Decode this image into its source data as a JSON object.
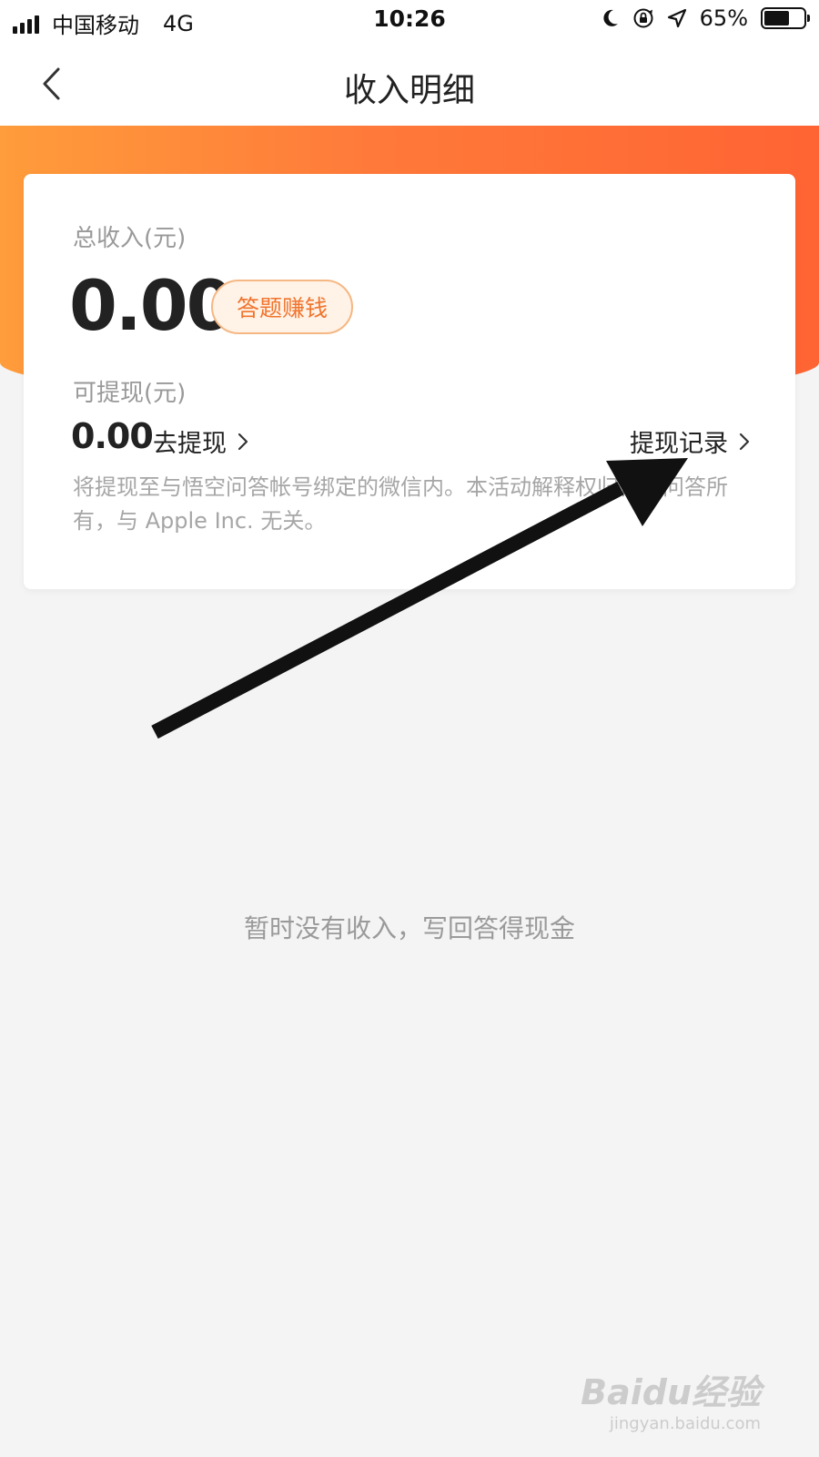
{
  "status_bar": {
    "carrier": "中国移动",
    "network": "4G",
    "time": "10:26",
    "battery": "65%",
    "battery_level": 0.65
  },
  "nav": {
    "title": "收入明细"
  },
  "card": {
    "total_label": "总收入(元)",
    "total_value": "0.00",
    "earn_button": "答题赚钱",
    "withdrawable_label": "可提现(元)",
    "withdrawable_value": "0.00",
    "go_withdraw": "去提现",
    "withdraw_record": "提现记录",
    "notice": "将提现至与悟空问答帐号绑定的微信内。本活动解释权归悟空问答所有，与 Apple Inc. 无关。"
  },
  "empty_state": {
    "message": "暂时没有收入，写回答得现金"
  },
  "watermark": {
    "logo": "Baidu经验",
    "url": "jingyan.baidu.com"
  },
  "colors": {
    "accent_orange": "#ff7a3a",
    "earn_button_text": "#f0742d"
  }
}
